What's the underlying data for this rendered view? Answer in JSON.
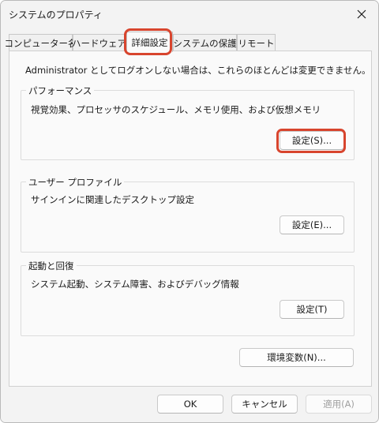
{
  "window": {
    "title": "システムのプロパティ",
    "close_icon": "close-icon"
  },
  "tabs": [
    {
      "label": "コンピューター名",
      "active": false
    },
    {
      "label": "ハードウェア",
      "active": false
    },
    {
      "label": "詳細設定",
      "active": true
    },
    {
      "label": "システムの保護",
      "active": false
    },
    {
      "label": "リモート",
      "active": false
    }
  ],
  "notice": "Administrator としてログオンしない場合は、これらのほとんどは変更できません。",
  "groups": {
    "performance": {
      "label": "パフォーマンス",
      "description": "視覚効果、プロセッサのスケジュール、メモリ使用、および仮想メモリ",
      "button": "設定(S)..."
    },
    "user_profiles": {
      "label": "ユーザー プロファイル",
      "description": "サインインに関連したデスクトップ設定",
      "button": "設定(E)..."
    },
    "startup_recovery": {
      "label": "起動と回復",
      "description": "システム起動、システム障害、およびデバッグ情報",
      "button": "設定(T)"
    }
  },
  "env_button": "環境変数(N)...",
  "footer": {
    "ok": "OK",
    "cancel": "キャンセル",
    "apply": "適用(A)"
  },
  "colors": {
    "highlight": "#d8452e",
    "panel": "#fafafa",
    "window": "#f3f3f3"
  }
}
